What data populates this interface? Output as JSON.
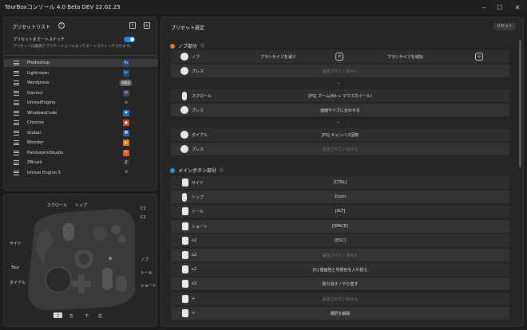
{
  "title": "TourBoxコンソール 4.0 Beta DEV 22.02.25",
  "window_controls": [
    "–",
    "☐",
    "✕"
  ],
  "left": {
    "heading": "プリセットリスト",
    "auto_switch_label": "プリセットをオートスイッチ",
    "auto_switch_desc": "プリセットは最適アプリケーションによってオートスウィッチされます。",
    "presets": [
      {
        "name": "Photoshop",
        "icon": "Ps",
        "color": "#1e4d8c",
        "selected": true
      },
      {
        "name": "Lightroom",
        "icon": "Lr",
        "color": "#1e4d8c"
      },
      {
        "name": "Wordpress",
        "icon": "未設定",
        "color": "#666"
      },
      {
        "name": "Davinci",
        "icon": "◎",
        "color": "#3b4a6a"
      },
      {
        "name": "UnrealEngine",
        "icon": "U",
        "color": "#222"
      },
      {
        "name": "WindowsCode",
        "icon": "◆",
        "color": "#1e6fc9"
      },
      {
        "name": "Chrome",
        "icon": "●",
        "color": "#c9482b"
      },
      {
        "name": "Global",
        "icon": "▦",
        "color": "#2a5fb0"
      },
      {
        "name": "Blender",
        "icon": "◐",
        "color": "#e07b1d"
      },
      {
        "name": "PaintstormStudio",
        "icon": "✦",
        "color": "#e2612a"
      },
      {
        "name": "ZBrush",
        "icon": "Z",
        "color": "#333"
      },
      {
        "name": "Unreal Engine 5",
        "icon": "U",
        "color": "#222"
      }
    ],
    "device_labels": {
      "scroll": "スクロール",
      "top": "トップ",
      "c1": "C1",
      "c2": "C2",
      "side": "サイド",
      "tour": "Tour",
      "dial": "ダイアル",
      "knob": "ノブ",
      "tall": "トール",
      "short": "ショート",
      "up": "上",
      "left": "左",
      "down": "下",
      "right": "右"
    }
  },
  "right": {
    "heading": "プリセット設定",
    "reset": "リセット",
    "knob_section": "ノブ部分",
    "main_section": "メインボタン部分",
    "knob": [
      {
        "cap": "ノブ",
        "left": "ブラシサイズを減少",
        "right": "ブラシサイズを増加"
      },
      {
        "cap": "プレス",
        "action": "設定されていません"
      }
    ],
    "scroll": [
      {
        "cap": "スクロール",
        "action": "[PS] ズーム(Alt + マウスホイール)"
      },
      {
        "cap": "プレス",
        "action": "画面サイズに合わせる"
      }
    ],
    "dial": [
      {
        "cap": "ダイアル",
        "action": "[PS] キャンバス回転"
      },
      {
        "cap": "プレス",
        "action": "設定されていません"
      }
    ],
    "main": [
      {
        "cap": "サイド",
        "action": "[CTRL]"
      },
      {
        "cap": "トップ",
        "action": "Zoom"
      },
      {
        "cap": "トール",
        "action": "[ALT]"
      },
      {
        "cap": "ショート",
        "action": "[SPACE]"
      },
      {
        "cap": "x2",
        "action": "[ESC]"
      },
      {
        "cap": "x2",
        "action": "設定されていません"
      },
      {
        "cap": "x2",
        "action": "[X] 描画色と背景色を入れ替え"
      },
      {
        "cap": "x2",
        "action": "取り消す / やり直す"
      },
      {
        "cap": "+",
        "action": "設定されていません"
      },
      {
        "cap": "+",
        "action": "選択を解除"
      }
    ]
  }
}
